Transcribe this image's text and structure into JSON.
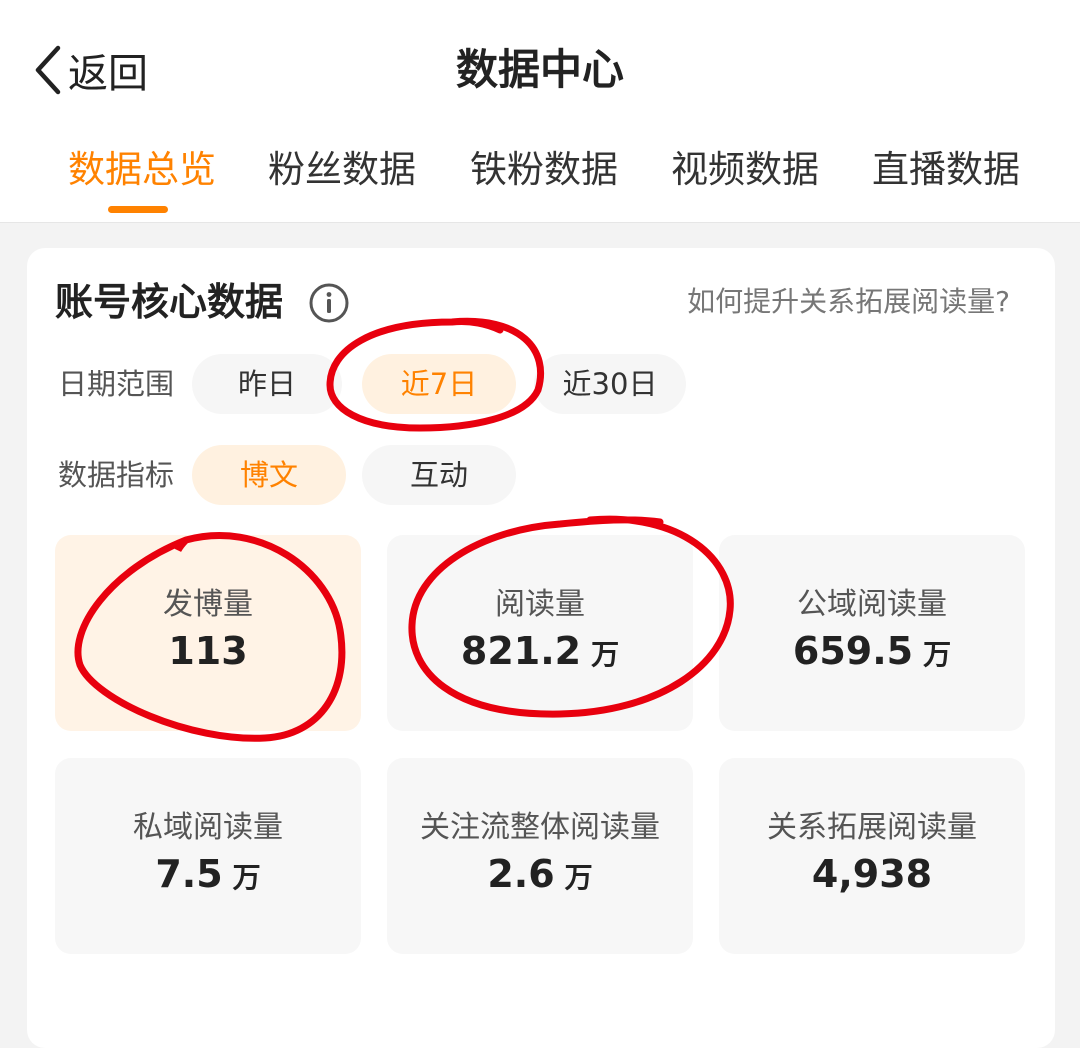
{
  "header": {
    "back_label": "返回",
    "title": "数据中心",
    "back_icon": "chevron-left-icon"
  },
  "tabs": [
    {
      "label": "数据总览",
      "active": true
    },
    {
      "label": "粉丝数据",
      "active": false
    },
    {
      "label": "铁粉数据",
      "active": false
    },
    {
      "label": "视频数据",
      "active": false
    },
    {
      "label": "直播数据",
      "active": false
    }
  ],
  "section": {
    "title": "账号核心数据",
    "info_icon": "info-icon",
    "help_link": "如何提升关系拓展阅读量?"
  },
  "date_range": {
    "label": "日期范围",
    "options": [
      "昨日",
      "近7日",
      "近30日"
    ],
    "selected": "近7日"
  },
  "metric_type": {
    "label": "数据指标",
    "options": [
      "博文",
      "互动"
    ],
    "selected": "博文"
  },
  "metrics": [
    {
      "label": "发博量",
      "value": "113",
      "unit": "",
      "selected": true
    },
    {
      "label": "阅读量",
      "value": "821.2",
      "unit": "万",
      "selected": false
    },
    {
      "label": "公域阅读量",
      "value": "659.5",
      "unit": "万",
      "selected": false
    },
    {
      "label": "私域阅读量",
      "value": "7.5",
      "unit": "万",
      "selected": false
    },
    {
      "label": "关注流整体阅读量",
      "value": "2.6",
      "unit": "万",
      "selected": false
    },
    {
      "label": "关系拓展阅读量",
      "value": "4,938",
      "unit": "",
      "selected": false
    }
  ],
  "colors": {
    "accent": "#ff8200",
    "accent_bg": "#fff1e0",
    "annotation": "#e8000e"
  }
}
